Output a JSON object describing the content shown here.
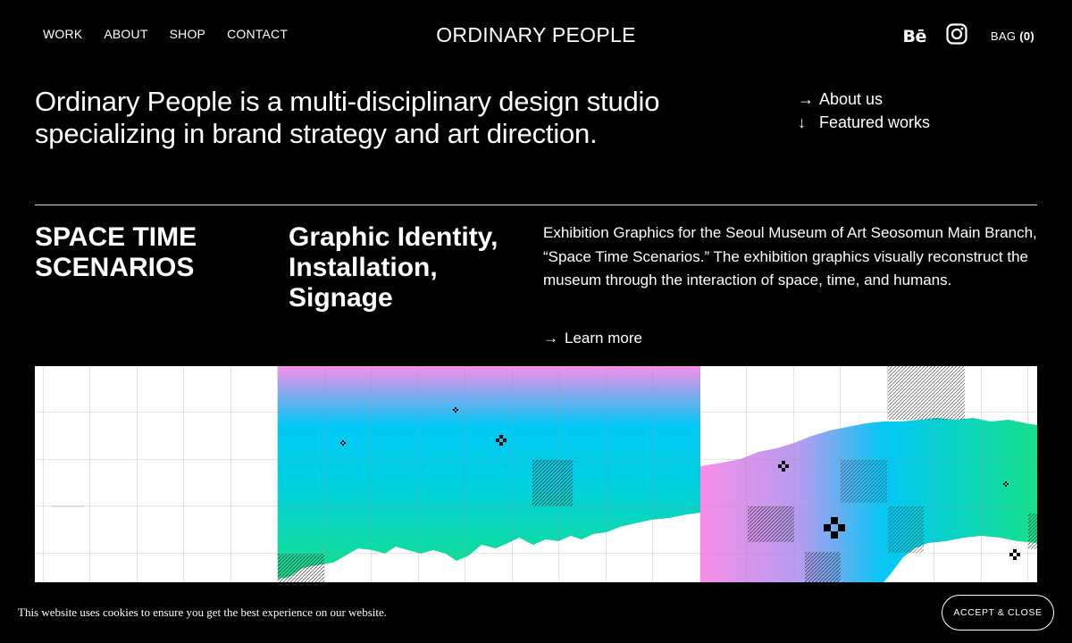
{
  "header": {
    "nav": [
      "WORK",
      "ABOUT",
      "SHOP",
      "CONTACT"
    ],
    "logo": "ORDINARY PEOPLE",
    "behance_icon": "behance-icon",
    "behance_glyph": "Bē",
    "instagram_icon": "instagram-icon",
    "bag_label": "BAG",
    "bag_count": "(0)"
  },
  "intro": {
    "text": "Ordinary People is a multi-disciplinary design studio specializing in brand strategy and art direction.",
    "links": [
      {
        "arrow": "→",
        "label": "About us"
      },
      {
        "arrow": "↓",
        "label": "Featured works"
      }
    ]
  },
  "project": {
    "title": "SPACE TIME SCENARIOS",
    "type": "Graphic Identity, Installation, Signage",
    "description": "Exhibition Graphics for the Seoul Museum of Art Seosomun Main Branch, “Space Time Scenarios.” The exhibition graphics visually reconstruct the museum through the interaction of space, time, and humans.",
    "learn_more_arrow": "→",
    "learn_more": "Learn more"
  },
  "artwork": {
    "colors": {
      "pink": "#f78ee8",
      "cyan": "#00c8f5",
      "green": "#16e08a",
      "violet": "#b39cf0"
    }
  },
  "cookie": {
    "text": "This website uses cookies to ensure you get the best experience on our website.",
    "button": "ACCEPT & CLOSE"
  }
}
